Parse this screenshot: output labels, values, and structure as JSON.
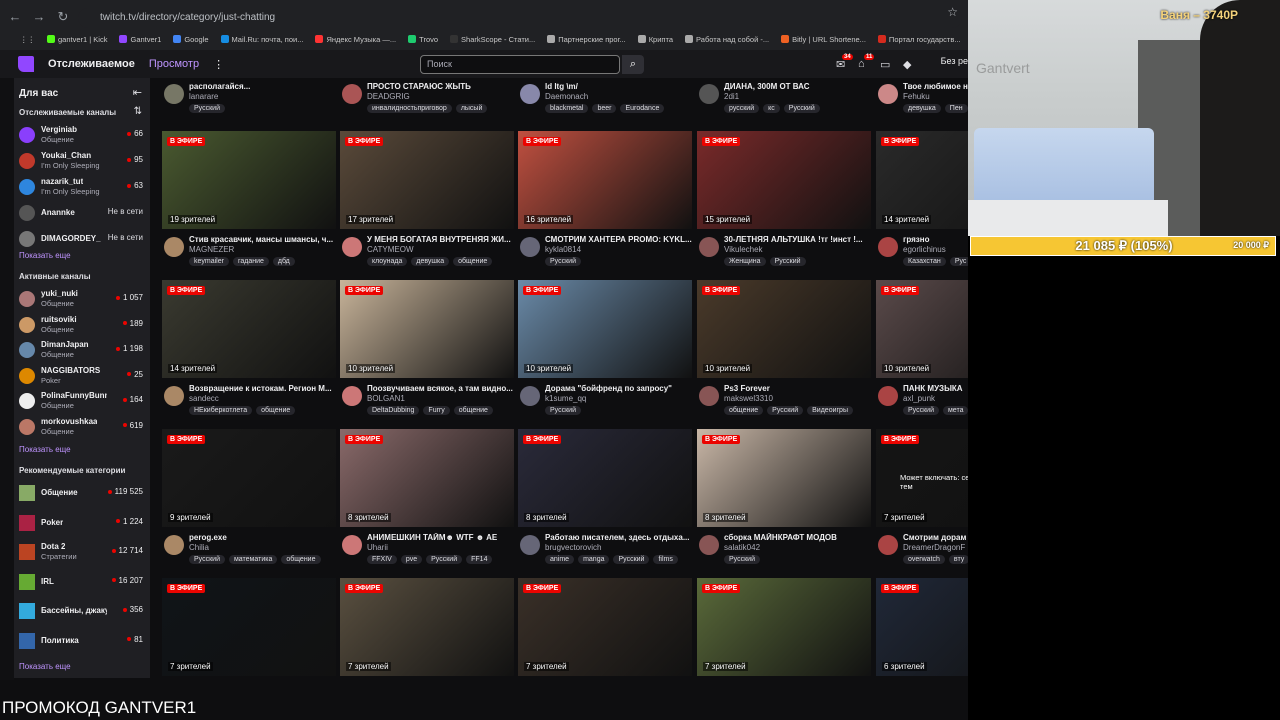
{
  "browser": {
    "url": "twitch.tv/directory/category/just-chatting",
    "bookmarks": [
      "gantver1 | Kick",
      "Gantver1",
      "Google",
      "Mail.Ru: почта, пои...",
      "Яндекс Музыка —...",
      "Trovo",
      "SharkScope - Стати...",
      "Партнерские прог...",
      "Крипта",
      "Работа над собой -...",
      "Bitly | URL Shortene...",
      "Портал государств..."
    ]
  },
  "twitch": {
    "nav_following": "Отслеживаемое",
    "nav_browse": "Просмотр",
    "search_placeholder": "Поиск",
    "notif_badge_1": "34",
    "notif_badge_2": "11",
    "get_bits": "Без ре"
  },
  "sidebar": {
    "header": "Для вас",
    "followed_header": "Отслеживаемые каналы",
    "followed": [
      {
        "name": "Verginiab",
        "cat": "Общение",
        "viewers": "66",
        "color": "#8a3ffc"
      },
      {
        "name": "Youkai_Chan",
        "cat": "I'm Only Sleeping",
        "viewers": "95",
        "color": "#c0392b"
      },
      {
        "name": "nazarik_tut",
        "cat": "I'm Only Sleeping",
        "viewers": "63",
        "color": "#2e86de"
      },
      {
        "name": "Anannke",
        "cat": "",
        "offline": "Не в сети",
        "color": "#555"
      },
      {
        "name": "DIMAGORDEY_",
        "cat": "",
        "offline": "Не в сети",
        "color": "#777"
      }
    ],
    "show_more": "Показать еще",
    "active_header": "Активные каналы",
    "active": [
      {
        "name": "yuki_nuki",
        "cat": "Общение",
        "viewers": "1 057",
        "color": "#a77"
      },
      {
        "name": "ruitsoviki",
        "cat": "Общение",
        "viewers": "189",
        "color": "#c96"
      },
      {
        "name": "DimanJapan",
        "cat": "Общение",
        "viewers": "1 198",
        "color": "#68a"
      },
      {
        "name": "NAGGIBATORS",
        "cat": "Poker",
        "viewers": "25",
        "color": "#d80"
      },
      {
        "name": "PolinaFunnyBunny",
        "cat": "Общение",
        "viewers": "164",
        "color": "#eee"
      },
      {
        "name": "morkovushkaa",
        "cat": "Общение",
        "viewers": "619",
        "color": "#b76"
      }
    ],
    "recommended_header": "Рекомендуемые категории",
    "categories": [
      {
        "name": "Общение",
        "sub": "",
        "viewers": "119 525",
        "color": "#8a6"
      },
      {
        "name": "Poker",
        "sub": "",
        "viewers": "1 224",
        "color": "#a24"
      },
      {
        "name": "Dota 2",
        "sub": "Стратегии",
        "viewers": "12 714",
        "color": "#b42"
      },
      {
        "name": "IRL",
        "sub": "",
        "viewers": "16 207",
        "color": "#6a3"
      },
      {
        "name": "Бассейны, джакузи...",
        "sub": "",
        "viewers": "356",
        "color": "#3ad"
      },
      {
        "name": "Политика",
        "sub": "",
        "viewers": "81",
        "color": "#36a"
      }
    ]
  },
  "grid": {
    "live_label": "В ЭФИРЕ",
    "top_row": [
      {
        "title": "располагайся...",
        "channel": "lanarare",
        "tags": [
          "Русский"
        ]
      },
      {
        "title": "ПРОСТО СТАРАЮС ЖЫТЬ",
        "channel": "DEADGRIG",
        "tags": [
          "инвалидностьприговор",
          "лысый"
        ]
      },
      {
        "title": "ld ltg \\m/",
        "channel": "Daemonach",
        "tags": [
          "blackmetal",
          "beer",
          "Eurodance"
        ]
      },
      {
        "title": "ДИАНА, 300М ОТ ВАС",
        "channel": "2di1",
        "tags": [
          "русский",
          "кс",
          "Русский"
        ]
      },
      {
        "title": "Твое любимое н",
        "channel": "Fehuku",
        "tags": [
          "девушка",
          "Пен"
        ]
      }
    ],
    "rows": [
      [
        {
          "viewers": "19 зрителей",
          "title": "Стив красавчик, мансы шмансы, ч...",
          "channel": "MAGNEZER",
          "tags": [
            "keymailer",
            "гадание",
            "дбд"
          ],
          "thumb": "#4a5a30"
        },
        {
          "viewers": "17 зрителей",
          "title": "У МЕНЯ БОГАТАЯ ВНУТРЕНЯЯ ЖИ...",
          "channel": "CATYMEOW",
          "tags": [
            "клоунада",
            "девушка",
            "общение"
          ],
          "thumb": "#5a4a3a"
        },
        {
          "viewers": "16 зрителей",
          "title": "СМОТРИМ ХАНТЕРА PROMO: KYKL...",
          "channel": "kykla0814",
          "tags": [
            "Русский"
          ],
          "thumb": "#c05040"
        },
        {
          "viewers": "15 зрителей",
          "title": "30-ЛЕТНЯЯ АЛЬТУШКА !тг !инст !...",
          "channel": "Vikulechek",
          "tags": [
            "Женщина",
            "Русский"
          ],
          "thumb": "#7a2a2a"
        },
        {
          "viewers": "14 зрителей",
          "title": "грязно",
          "channel": "egorlichinus",
          "tags": [
            "Казахстан",
            "Рус"
          ],
          "thumb": "#2a2a2a"
        }
      ],
      [
        {
          "viewers": "14 зрителей",
          "title": "Возвращение к истокам. Регион М...",
          "channel": "sandecc",
          "tags": [
            "НЕкиберкотлета",
            "общение"
          ],
          "thumb": "#3a3a30"
        },
        {
          "viewers": "10 зрителей",
          "title": "Поозвучиваем всякое, а там видно...",
          "channel": "BOLGAN1",
          "tags": [
            "DeltaDubbing",
            "Furry",
            "общение"
          ],
          "thumb": "#c8b49a"
        },
        {
          "viewers": "10 зрителей",
          "title": "Дорама \"бойфренд по запросу\"",
          "channel": "k1sume_qq",
          "tags": [
            "Русский"
          ],
          "thumb": "#6a8aa8"
        },
        {
          "viewers": "10 зрителей",
          "title": "Ps3 Forever",
          "channel": "makswel3310",
          "tags": [
            "общение",
            "Русский",
            "Видеоигры"
          ],
          "thumb": "#4a3a2a"
        },
        {
          "viewers": "10 зрителей",
          "title": "ПАНК МУЗЫКА",
          "channel": "axl_punk",
          "tags": [
            "Русский",
            "мета"
          ],
          "thumb": "#5a4a4a"
        }
      ],
      [
        {
          "viewers": "9 зрителей",
          "title": "perog.exe",
          "channel": "Chilia",
          "tags": [
            "Русский",
            "математика",
            "общение"
          ],
          "thumb": "#1a1a1a"
        },
        {
          "viewers": "8 зрителей",
          "title": "АНИМЕШКИН ТАЙМ☻ WTF ☻ AE",
          "channel": "Uharii",
          "tags": [
            "FFXIV",
            "pve",
            "Русский",
            "FF14"
          ],
          "thumb": "#8a6a6a"
        },
        {
          "viewers": "8 зрителей",
          "title": "Работаю писателем, здесь отдыха...",
          "channel": "brugvectorovich",
          "tags": [
            "anime",
            "manga",
            "Русский",
            "films"
          ],
          "thumb": "#2a2a3a"
        },
        {
          "viewers": "8 зрителей",
          "title": "сборка МАЙНКРАФТ МОДОВ",
          "channel": "salatik042",
          "tags": [
            "Русский"
          ],
          "thumb": "#c9b7a7"
        },
        {
          "viewers": "7 зрителей",
          "title": "Смотрим дорам",
          "channel": "DreamerDragonF",
          "tags": [
            "overwatch",
            "вту"
          ],
          "thumb": "#151515"
        }
      ],
      [
        {
          "viewers": "7 зрителей",
          "title": "",
          "channel": "",
          "tags": [],
          "thumb": "#101418"
        },
        {
          "viewers": "7 зрителей",
          "title": "",
          "channel": "",
          "tags": [],
          "thumb": "#5a5040"
        },
        {
          "viewers": "7 зрителей",
          "title": "",
          "channel": "",
          "tags": [],
          "thumb": "#3a3028"
        },
        {
          "viewers": "7 зрителей",
          "title": "",
          "channel": "",
          "tags": [],
          "thumb": "#5a6a3a"
        },
        {
          "viewers": "6 зрителей",
          "title": "",
          "channel": "",
          "tags": [],
          "thumb": "#202838"
        }
      ]
    ]
  },
  "thumb_overlays": {
    "row3_col5": "Может включать: се тем"
  },
  "stream_overlay": {
    "cam_title": "Ваня – 3740Р",
    "cam_watermark": "Gantvert",
    "goal_current": "21 085 ₽ (105%)",
    "goal_target": "20 000 ₽",
    "goal_progress": 1.0,
    "promo": "ПРОМОКОД GANTVER1"
  }
}
